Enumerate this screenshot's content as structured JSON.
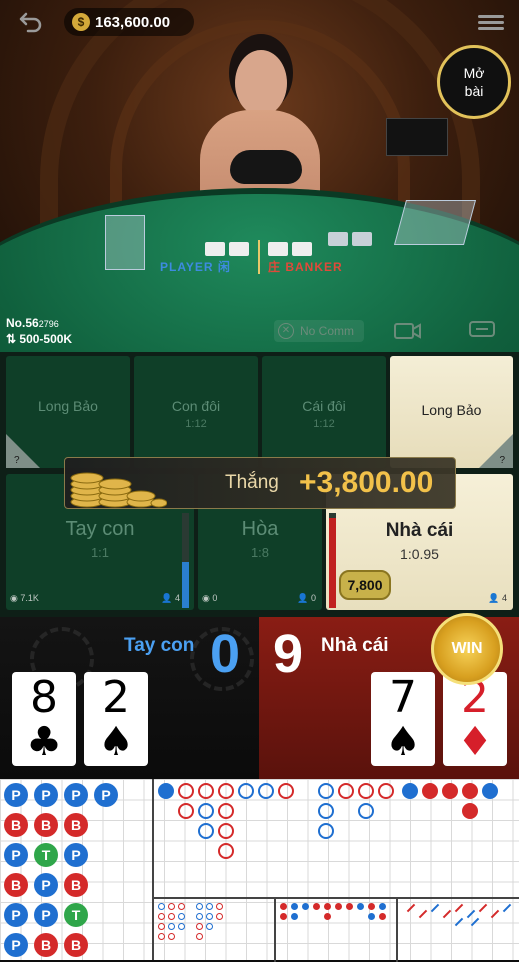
{
  "header": {
    "balance": "163,600.00",
    "currency_symbol": "$",
    "open_card_button": [
      "Mở",
      "bài"
    ]
  },
  "table_info": {
    "round_prefix": "No.56",
    "round_suffix": "2796",
    "limit": "500-500K",
    "no_commission": "No Comm",
    "felt_player": "PLAYER 闲",
    "felt_banker": "庄 BANKER"
  },
  "bets": {
    "long_bao_left": {
      "name": "Long Bảo",
      "q": "?"
    },
    "player_pair": {
      "name": "Con đôi",
      "odds": "1:12"
    },
    "banker_pair": {
      "name": "Cái đôi",
      "odds": "1:12"
    },
    "long_bao_right": {
      "name": "Long Bảo",
      "q": "?"
    },
    "player": {
      "name": "Tay con",
      "odds": "1:1",
      "stat_left": "7.1K",
      "stat_right": "4"
    },
    "tie": {
      "name": "Hòa",
      "odds": "1:8",
      "stat_left": "0",
      "stat_right": "0"
    },
    "banker": {
      "name": "Nhà cái",
      "odds": "1:0.95",
      "stat_right": "4",
      "chip": "7,800"
    }
  },
  "bet_ratio": {
    "player": 0.48,
    "banker": 0.95
  },
  "win_banner": {
    "label": "Thắng",
    "amount": "+3,800.00"
  },
  "result": {
    "player_label": "Tay con",
    "player_score": "0",
    "banker_label": "Nhà cái",
    "banker_score": "9",
    "win_seal": "WIN",
    "player_cards": [
      {
        "rank": "8",
        "suit": "♣"
      },
      {
        "rank": "2",
        "suit": "♠"
      }
    ],
    "banker_cards": [
      {
        "rank": "7",
        "suit": "♠"
      },
      {
        "rank": "2",
        "suit": "♦"
      }
    ]
  },
  "roadmap": {
    "bead_rows": [
      [
        "P",
        "P",
        "P",
        "P"
      ],
      [
        "B",
        "B",
        "B"
      ],
      [
        "P",
        "T",
        "P"
      ],
      [
        "B",
        "P",
        "B"
      ],
      [
        "P",
        "P",
        "T"
      ],
      [
        "P",
        "B",
        "B"
      ]
    ]
  },
  "colors": {
    "player": "#1f6fd0",
    "banker": "#d42a2a",
    "tie": "#2fa64a",
    "gold": "#f2c14a"
  }
}
